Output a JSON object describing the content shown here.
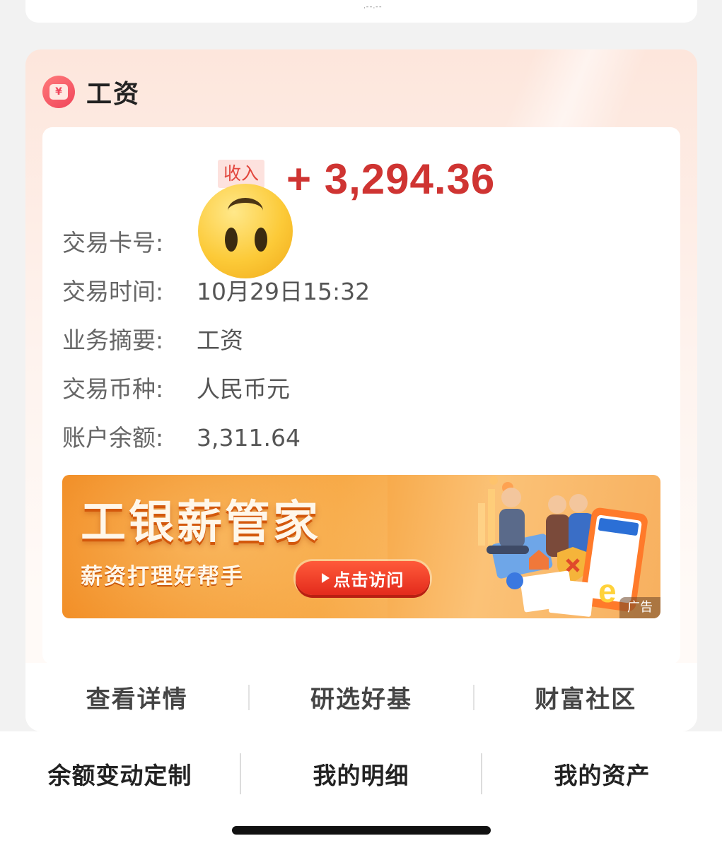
{
  "top_card": {
    "dots": "ᐧᐨᐨᐧᐨᐨ"
  },
  "message_card": {
    "title": "工资",
    "icon": "yen-message-icon",
    "income_tag": "收入",
    "amount": "+ 3,294.36",
    "amount_color": "#cf3432",
    "details": [
      {
        "label": "交易卡号:",
        "value": ""
      },
      {
        "label": "交易时间:",
        "value": "10月29日15:32"
      },
      {
        "label": "业务摘要:",
        "value": "工资"
      },
      {
        "label": "交易币种:",
        "value": "人民币元"
      },
      {
        "label": "账户余额:",
        "value": "3,311.64"
      }
    ],
    "overlay": "upside-down-face-emoji"
  },
  "banner": {
    "title": "工银薪管家",
    "subtitle": "薪资打理好帮手",
    "button": "点击访问",
    "ad_label": "广告",
    "accent": "#f08418"
  },
  "card_actions": [
    {
      "label": "查看详情"
    },
    {
      "label": "研选好基"
    },
    {
      "label": "财富社区"
    }
  ],
  "bottom_nav": [
    {
      "label": "余额变动定制"
    },
    {
      "label": "我的明细"
    },
    {
      "label": "我的资产"
    }
  ]
}
